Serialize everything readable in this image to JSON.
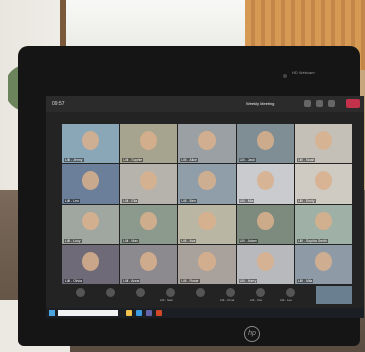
{
  "meeting": {
    "time": "09:57",
    "title": "Weekly Meeting",
    "participants": [
      {
        "name": "Lilli - Jenny",
        "color": "#8aa7b8"
      },
      {
        "name": "Lilli - Sophie",
        "color": "#a6a38e"
      },
      {
        "name": "Lilli - Alice",
        "color": "#9aa0a4"
      },
      {
        "name": "Lilli - Jack",
        "color": "#7e8e94"
      },
      {
        "name": "Lilli - Noah",
        "color": "#c4c0b7"
      },
      {
        "name": "Lilli - Leo",
        "color": "#6b7f9a"
      },
      {
        "name": "Lilli - Ella",
        "color": "#b6b3ad"
      },
      {
        "name": "Lilli - Ben",
        "color": "#8f9ea8"
      },
      {
        "name": "Lilli - Mia",
        "color": "#c9cbcf"
      },
      {
        "name": "Lilli - Emily",
        "color": "#d0cbc2"
      },
      {
        "name": "Lilli - Lucy",
        "color": "#a0a7a0"
      },
      {
        "name": "Lilli - Max",
        "color": "#8c9a8e"
      },
      {
        "name": "Lilli - Ava",
        "color": "#b9b6a4"
      },
      {
        "name": "Lilli - Adam",
        "color": "#7d8b7e"
      },
      {
        "name": "Lilli - Sophia Smith",
        "color": "#9fb0a6"
      },
      {
        "name": "Lilli - Olivia",
        "color": "#6e6a78"
      },
      {
        "name": "Lilli - Anna",
        "color": "#8c8a8f"
      },
      {
        "name": "Lilli - Rosie",
        "color": "#a9a19c"
      },
      {
        "name": "Lilli - Harry",
        "color": "#b8b9bd"
      },
      {
        "name": "Lilli - Mila",
        "color": "#8e9ba6"
      }
    ],
    "bottom_strip": [
      "",
      "",
      "",
      "Lilli - Sam",
      "",
      "Lilli - Omar",
      "Lilli - Zoe",
      "Lilli - Lee"
    ]
  },
  "device": {
    "camera_label": "HD Webcam",
    "brand": "hp"
  },
  "colors": {
    "leave_button": "#c4314b",
    "taskbar": "#1b1e22"
  }
}
